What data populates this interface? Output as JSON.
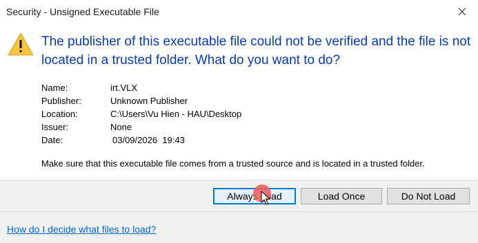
{
  "window": {
    "title": "Security - Unsigned Executable File",
    "close_icon": "close-icon"
  },
  "headline": "The publisher of this executable file could not be verified and the file is not located in a trusted folder. What do you want to do?",
  "warning_icon": "warning-icon",
  "details": {
    "name_label": "Name:",
    "name_value": "irt.VLX",
    "publisher_label": "Publisher:",
    "publisher_value": "Unknown Publisher",
    "location_label": "Location:",
    "location_value": "C:\\Users\\Vu Hien - HAU\\Desktop",
    "issuer_label": "Issuer:",
    "issuer_value": "None",
    "date_label": "Date:",
    "date_value": "03/09/2026  19:43"
  },
  "note": "Make sure that this executable file comes from a trusted source and is located in a trusted folder.",
  "buttons": {
    "always_load": "Always Load",
    "load_once": "Load Once",
    "do_not_load": "Do Not Load"
  },
  "help_link": "How do I decide what files to load?",
  "colors": {
    "headline": "#0a3aa8",
    "link": "#0066cc",
    "focused_button_border": "#0078d7",
    "footer": "#f0f0f0",
    "click_indicator": "#f05a5a"
  }
}
